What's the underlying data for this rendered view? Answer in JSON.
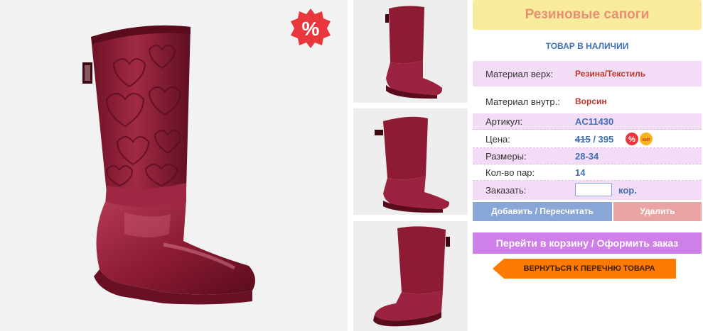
{
  "product": {
    "title": "Резиновые сапоги",
    "stock_status": "ТОВАР В НАЛИЧИИ",
    "sale_badge": "%"
  },
  "specs": {
    "material_top_label": "Материал верх:",
    "material_top_value": "Резина/Текстиль",
    "material_inner_label": "Материал внутр.:",
    "material_inner_value": "Ворсин",
    "article_label": "Артикул:",
    "article_value": "AC11430",
    "price_label": "Цена:",
    "price_old": "415",
    "price_sep": " / ",
    "price_new": "395",
    "sizes_label": "Размеры:",
    "sizes_value": "28-34",
    "pairs_label": "Кол-во пар:",
    "pairs_value": "14",
    "order_label": "Заказать:",
    "order_value": "",
    "order_unit": "кор."
  },
  "badges": {
    "sale": "%",
    "hit": "хит"
  },
  "buttons": {
    "add": "Добавить / Пересчитать",
    "delete": "Удалить",
    "cart": "Перейти в корзину / Оформить заказ",
    "back": "ВЕРНУТЬСЯ К ПЕРЕЧНЮ ТОВАРА"
  },
  "colors": {
    "title_bg": "#f8ec9c",
    "title_text": "#e88f73",
    "accent_blue": "#3f6fb6",
    "row_lilac": "#f3dcf6",
    "boot": "#8e1b33",
    "add_button": "#88a6d6",
    "delete_button": "#eaa4a4",
    "cart_button": "#cf80e8",
    "back_button": "#ff7a00"
  }
}
